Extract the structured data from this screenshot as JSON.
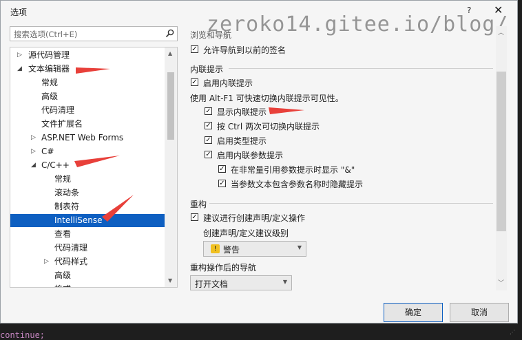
{
  "window": {
    "title": "选项",
    "help": "?",
    "close": "✕"
  },
  "watermark": "zeroko14.gitee.io/blog/",
  "search": {
    "placeholder": "搜索选项(Ctrl+E)"
  },
  "tree": {
    "items": [
      {
        "label": "源代码管理",
        "expander": "▷"
      },
      {
        "label": "文本编辑器",
        "expander": "◢"
      },
      {
        "label": "常规",
        "expander": ""
      },
      {
        "label": "高级",
        "expander": ""
      },
      {
        "label": "代码清理",
        "expander": ""
      },
      {
        "label": "文件扩展名",
        "expander": ""
      },
      {
        "label": "ASP.NET Web Forms",
        "expander": "▷"
      },
      {
        "label": "C#",
        "expander": "▷"
      },
      {
        "label": "C/C++",
        "expander": "◢"
      },
      {
        "label": "常规",
        "expander": ""
      },
      {
        "label": "滚动条",
        "expander": ""
      },
      {
        "label": "制表符",
        "expander": ""
      },
      {
        "label": "IntelliSense",
        "expander": ""
      },
      {
        "label": "查看",
        "expander": ""
      },
      {
        "label": "代码清理",
        "expander": ""
      },
      {
        "label": "代码样式",
        "expander": "▷"
      },
      {
        "label": "高级",
        "expander": ""
      },
      {
        "label": "格式",
        "expander": ""
      }
    ]
  },
  "right": {
    "browse_nav": {
      "header": "浏览和导航",
      "allow_nav_label": "允许导航到以前的签名"
    },
    "inline": {
      "header": "内联提示",
      "enable_label": "启用内联提示",
      "alt_text": "使用 Alt-F1 可快速切换内联提示可见性。",
      "show_label": "显示内联提示",
      "ctrl_label": "按 Ctrl 两次可切换内联提示",
      "type_label": "启用类型提示",
      "param_label": "启用内联参数提示",
      "nonconst_label": "在非常量引用参数提示时显示 \"&\"",
      "hide_label": "当参数文本包含参数名称时隐藏提示"
    },
    "refactor": {
      "header": "重构",
      "suggest_label": "建议进行创建声明/定义操作",
      "level_label": "创建声明/定义建议级别",
      "level_value": "警告",
      "nav_label": "重构操作后的导航",
      "nav_value": "打开文档"
    }
  },
  "buttons": {
    "ok": "确定",
    "cancel": "取消"
  },
  "bg_code": {
    "line_a": "continue;"
  },
  "colors": {
    "selection": "#0e5fc1",
    "annotation_arrow": "#e8403a"
  }
}
